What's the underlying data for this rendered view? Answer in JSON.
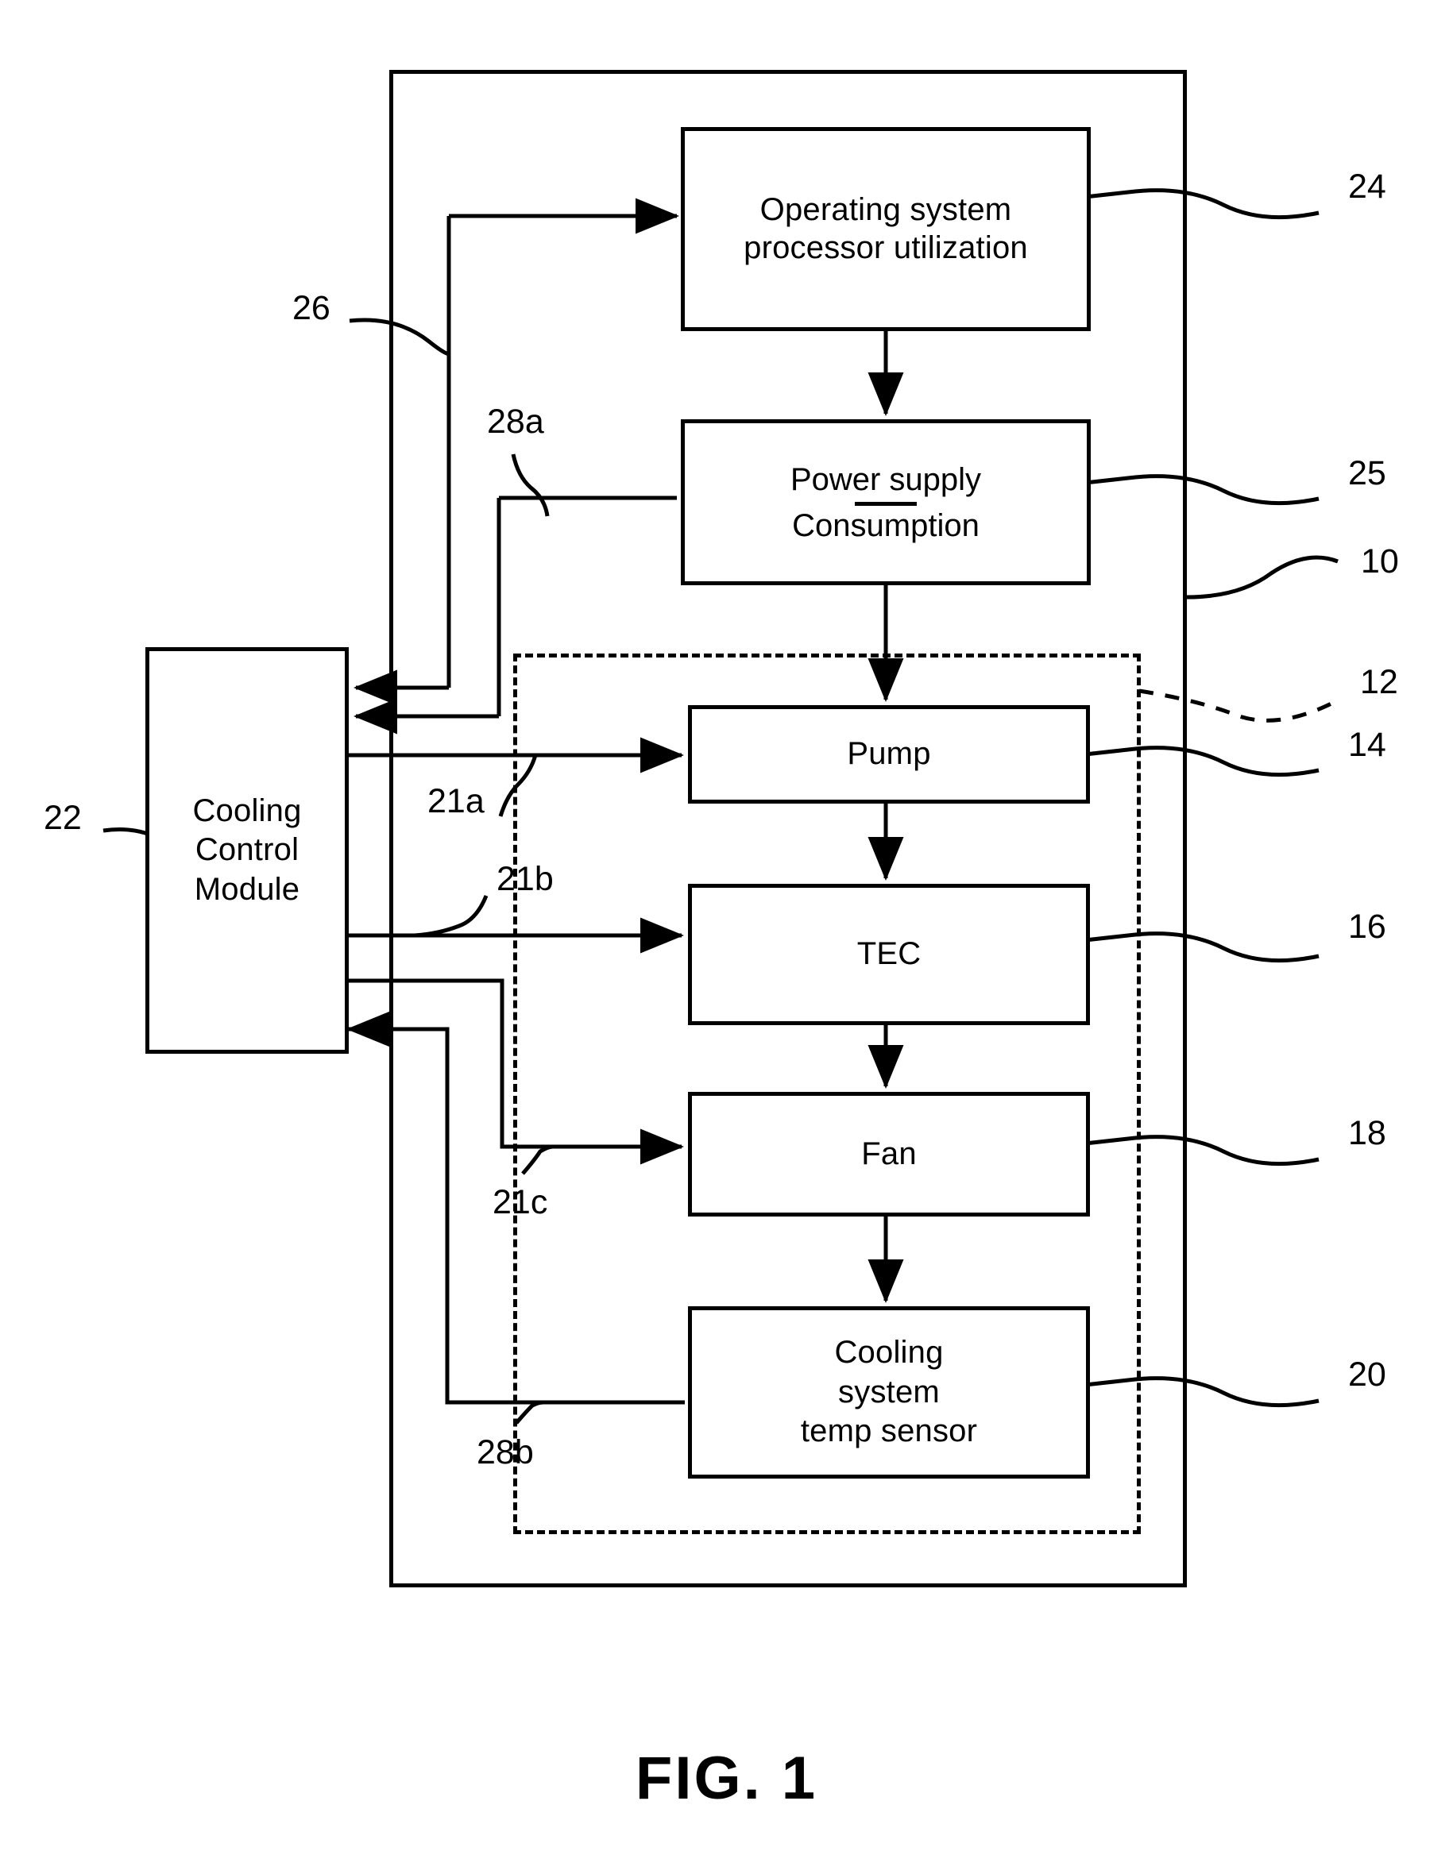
{
  "figure": {
    "caption": "FIG. 1",
    "title": "Cooling control module block diagram"
  },
  "enclosures": [
    {
      "id": "10",
      "ref": "10",
      "style": "solid",
      "name": "system-enclosure"
    },
    {
      "id": "12",
      "ref": "12",
      "style": "dashed",
      "name": "cooling-subsystem-enclosure"
    }
  ],
  "boxes": {
    "os_processor_utilization": {
      "label": "Operating system\nprocessor utilization",
      "ref": "24"
    },
    "power_supply": {
      "line1": "Power supply",
      "line2": "Consumption",
      "ref": "25"
    },
    "pump": {
      "label": "Pump",
      "ref": "14"
    },
    "tec": {
      "label": "TEC",
      "ref": "16"
    },
    "fan": {
      "label": "Fan",
      "ref": "18"
    },
    "temp_sensor": {
      "label": "Cooling\nsystem\ntemp sensor",
      "ref": "20"
    },
    "cooling_control_module": {
      "label": "Cooling\nControl\nModule",
      "ref": "22"
    }
  },
  "signal_refs": {
    "feedback_os": "26",
    "feedback_power": "28a",
    "control_pump": "21a",
    "control_tec": "21b",
    "control_fan": "21c",
    "feedback_temp": "28b"
  },
  "reference_numerals": [
    "10",
    "12",
    "14",
    "16",
    "18",
    "20",
    "21a",
    "21b",
    "21c",
    "22",
    "24",
    "25",
    "26",
    "28a",
    "28b"
  ],
  "colors": {
    "stroke": "#000000",
    "background": "#ffffff"
  }
}
